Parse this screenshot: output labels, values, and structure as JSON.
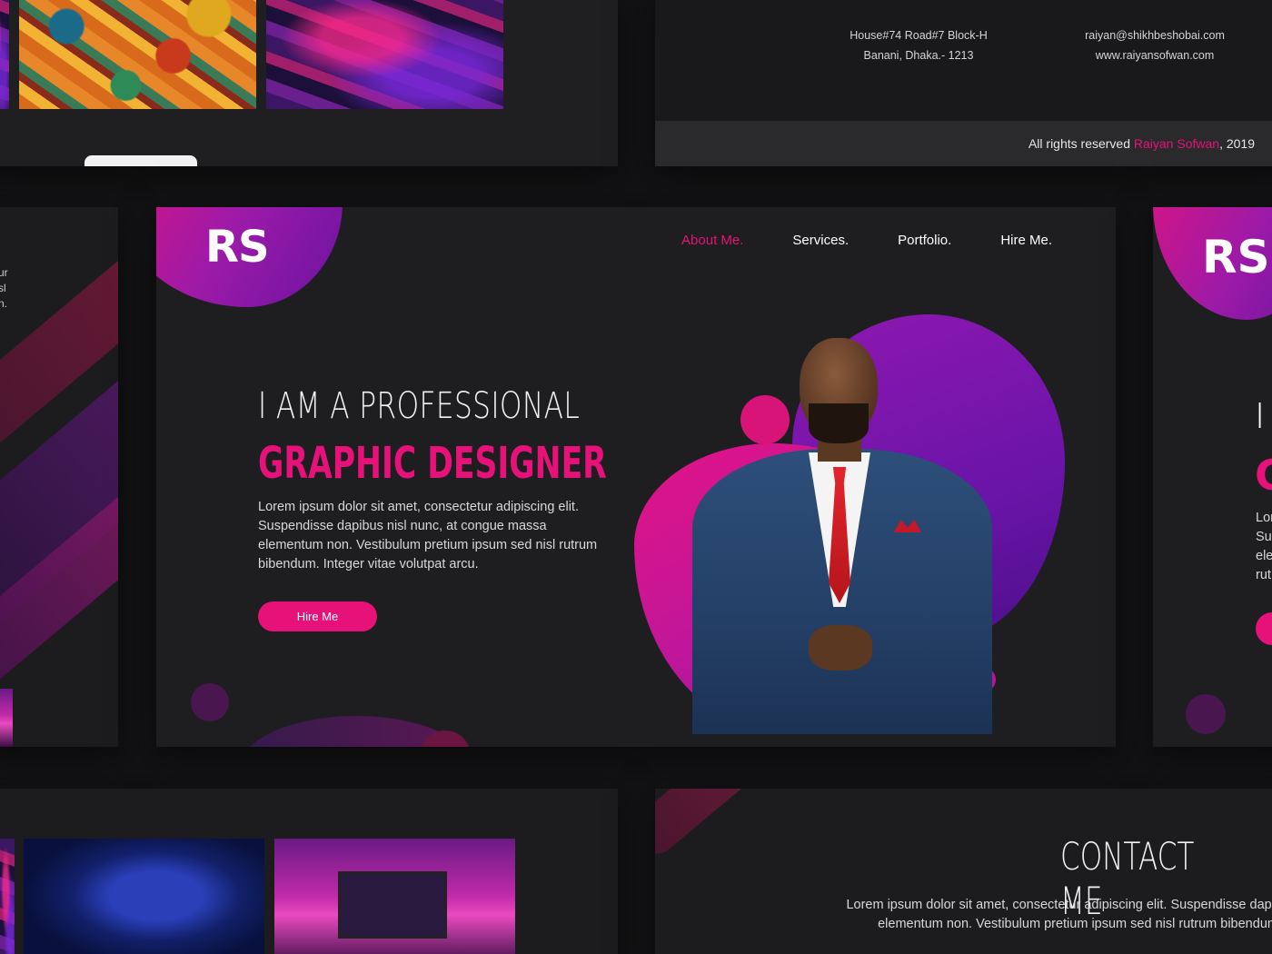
{
  "hero": {
    "logo": "RS",
    "nav": [
      {
        "label": "About Me.",
        "active": true
      },
      {
        "label": "Services.",
        "active": false
      },
      {
        "label": "Portfolio.",
        "active": false
      },
      {
        "label": "Hire Me.",
        "active": false
      }
    ],
    "headline_line1": "I AM A PROFESSIONAL",
    "headline_line2": "GRAPHIC DESIGNER",
    "body_text": "Lorem ipsum dolor sit amet, consectetur adipiscing elit. Suspendisse dapibus nisl nunc, at congue massa elementum non. Vestibulum pretium ipsum sed nisl rutrum bibendum. Integer vitae volutpat arcu.",
    "cta_label": "Hire Me"
  },
  "footer_preview": {
    "address_line1": "House#74 Road#7 Block-H",
    "address_line2": "Banani, Dhaka.- 1213",
    "email": "raiyan@shikhbeshobai.com",
    "website": "www.raiyansofwan.com",
    "copyright_prefix": "All rights reserved ",
    "copyright_name": "Raiyan Sofwan",
    "copyright_suffix": ", 2019"
  },
  "right_preview": {
    "logo": "RS",
    "line1": "I /",
    "line2": "G",
    "text_fragments": [
      "Lor",
      "Sus",
      "ele",
      "rut"
    ]
  },
  "left_preview": {
    "text_fragments": [
      "ur",
      "sl",
      "n."
    ]
  },
  "contact_preview": {
    "title": "CONTACT ME",
    "body_line1": "Lorem ipsum dolor sit amet, consectetur adipiscing elit. Suspendisse dapib",
    "body_line2": "elementum non. Vestibulum pretium ipsum sed nisl rutrum bibendum."
  },
  "colors": {
    "accent": "#e6127a",
    "purple": "#6a14a8",
    "background": "#141416",
    "card": "#1e1e20"
  }
}
